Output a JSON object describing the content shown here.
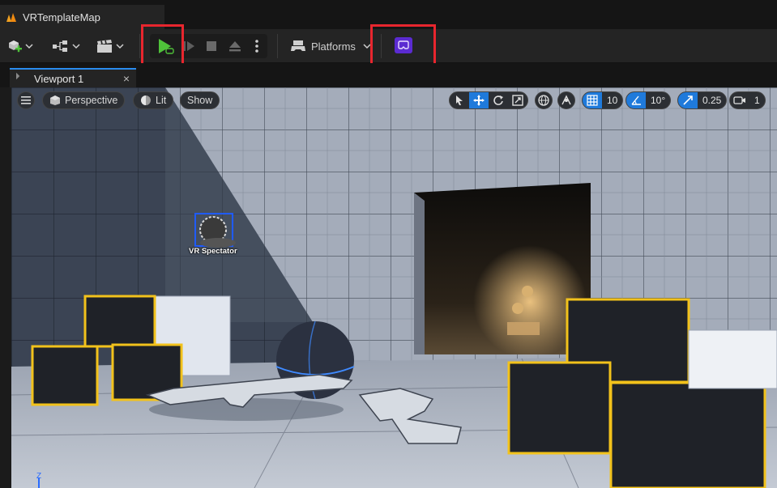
{
  "app": {
    "document_tab_title": "VRTemplateMap"
  },
  "toolbar": {
    "platforms_label": "Platforms",
    "add_icon": "add-actor-icon",
    "blueprint_icon": "blueprint-icon",
    "cinematics_icon": "clapper-icon",
    "play_icon": "play-icon",
    "vr_preview_icon": "vr-headset-icon"
  },
  "viewport_tab": {
    "label": "Viewport 1",
    "close_glyph": "×"
  },
  "viewport_toolbar": {
    "perspective_label": "Perspective",
    "lit_label": "Lit",
    "show_label": "Show",
    "grid_snap_value": "10",
    "rotation_snap_value": "10°",
    "scale_snap_value": "0.25",
    "camera_speed_value": "1"
  },
  "scene": {
    "spectator_label": "VR Spectator",
    "axis_label": "Z"
  },
  "colors": {
    "accent_blue": "#1f7adb",
    "highlight_red": "#e8262e",
    "play_green": "#4fc23a",
    "vr_purple": "#5b2bd1",
    "cube_outline": "#f2c21b"
  }
}
